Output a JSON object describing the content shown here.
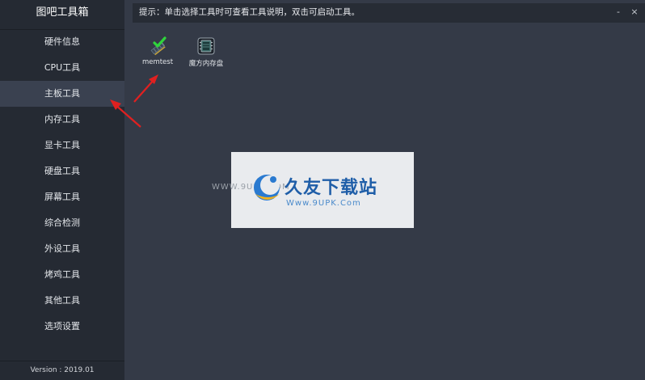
{
  "app": {
    "title": "图吧工具箱",
    "version": "Version : 2019.01"
  },
  "sidebar": {
    "items": [
      {
        "label": "硬件信息"
      },
      {
        "label": "CPU工具"
      },
      {
        "label": "主板工具"
      },
      {
        "label": "内存工具"
      },
      {
        "label": "显卡工具"
      },
      {
        "label": "硬盘工具"
      },
      {
        "label": "屏幕工具"
      },
      {
        "label": "综合检测"
      },
      {
        "label": "外设工具"
      },
      {
        "label": "烤鸡工具"
      },
      {
        "label": "其他工具"
      },
      {
        "label": "选项设置"
      }
    ],
    "active_index": 2
  },
  "topbar": {
    "hint": "提示：单击选择工具时可查看工具说明，双击可启动工具。",
    "minimize": "-",
    "close": "×"
  },
  "tools": [
    {
      "label": "memtest",
      "icon": "memtest-icon"
    },
    {
      "label": "魔方内存盘",
      "icon": "ram-disk-icon"
    }
  ],
  "watermark": {
    "site_name": "久友下载站",
    "url": "Www.9UPK.Com",
    "url_left": "WWW.9UPK.COM"
  },
  "colors": {
    "background": "#343a47",
    "sidebar": "#252a33",
    "active_item": "#3a4150",
    "arrow": "#e02020"
  }
}
